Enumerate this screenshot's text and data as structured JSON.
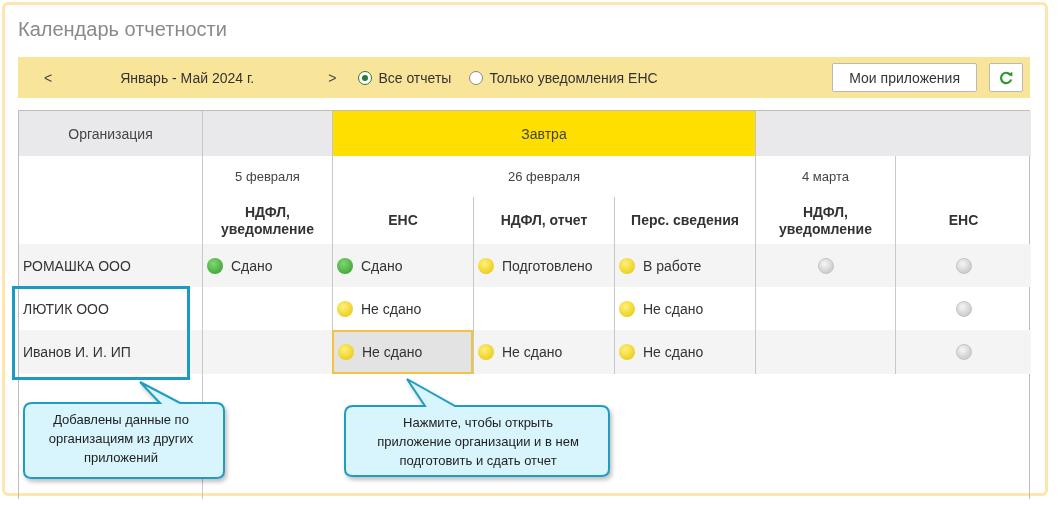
{
  "title": "Календарь отчетности",
  "toolbar": {
    "prev": "<",
    "period": "Январь - Май 2024 г.",
    "next": ">",
    "filters": [
      {
        "label": "Все отчеты",
        "selected": true
      },
      {
        "label": "Только уведомления ЕНС",
        "selected": false
      }
    ],
    "apps_button": "Мои приложения"
  },
  "table": {
    "org_header": "Организация",
    "groups": [
      {
        "date": "5 февраля",
        "columns": [
          "НДФЛ,\nуведомление"
        ]
      },
      {
        "tag": "Завтра",
        "date": "26 февраля",
        "columns": [
          "ЕНС",
          "НДФЛ, отчет",
          "Перс. сведения"
        ]
      },
      {
        "date": "4 марта",
        "columns": [
          "НДФЛ,\nуведомление"
        ]
      },
      {
        "columns": [
          "ЕНС"
        ]
      }
    ],
    "rows": [
      {
        "organization": "РОМАШКА ООО",
        "cells": [
          {
            "kind": "done",
            "text": "Сдано",
            "selected": false
          },
          {
            "kind": "done",
            "text": "Сдано",
            "selected": false
          },
          {
            "kind": "pending",
            "text": "Подготовлено",
            "selected": false
          },
          {
            "kind": "pending",
            "text": "В работе",
            "selected": false
          },
          {
            "kind": "none",
            "selected": false
          },
          {
            "kind": "none",
            "selected": false
          }
        ]
      },
      {
        "organization": "ЛЮТИК ООО",
        "cells": [
          null,
          {
            "kind": "pending",
            "text": "Не сдано",
            "selected": false
          },
          null,
          {
            "kind": "pending",
            "text": "Не сдано",
            "selected": false
          },
          null,
          {
            "kind": "none",
            "selected": false
          }
        ]
      },
      {
        "organization": "Иванов И. И. ИП",
        "cells": [
          null,
          {
            "kind": "pending",
            "text": "Не сдано",
            "selected": true
          },
          {
            "kind": "pending",
            "text": "Не сдано",
            "selected": false
          },
          {
            "kind": "pending",
            "text": "Не сдано",
            "selected": false
          },
          null,
          {
            "kind": "none",
            "selected": false
          }
        ]
      }
    ]
  },
  "callouts": [
    {
      "text": "Добавлены данные по\nорганизациям из других\nприложений"
    },
    {
      "text": "Нажмите, чтобы открыть\nприложение организации и в нем\nподготовить и сдать отчет"
    }
  ]
}
